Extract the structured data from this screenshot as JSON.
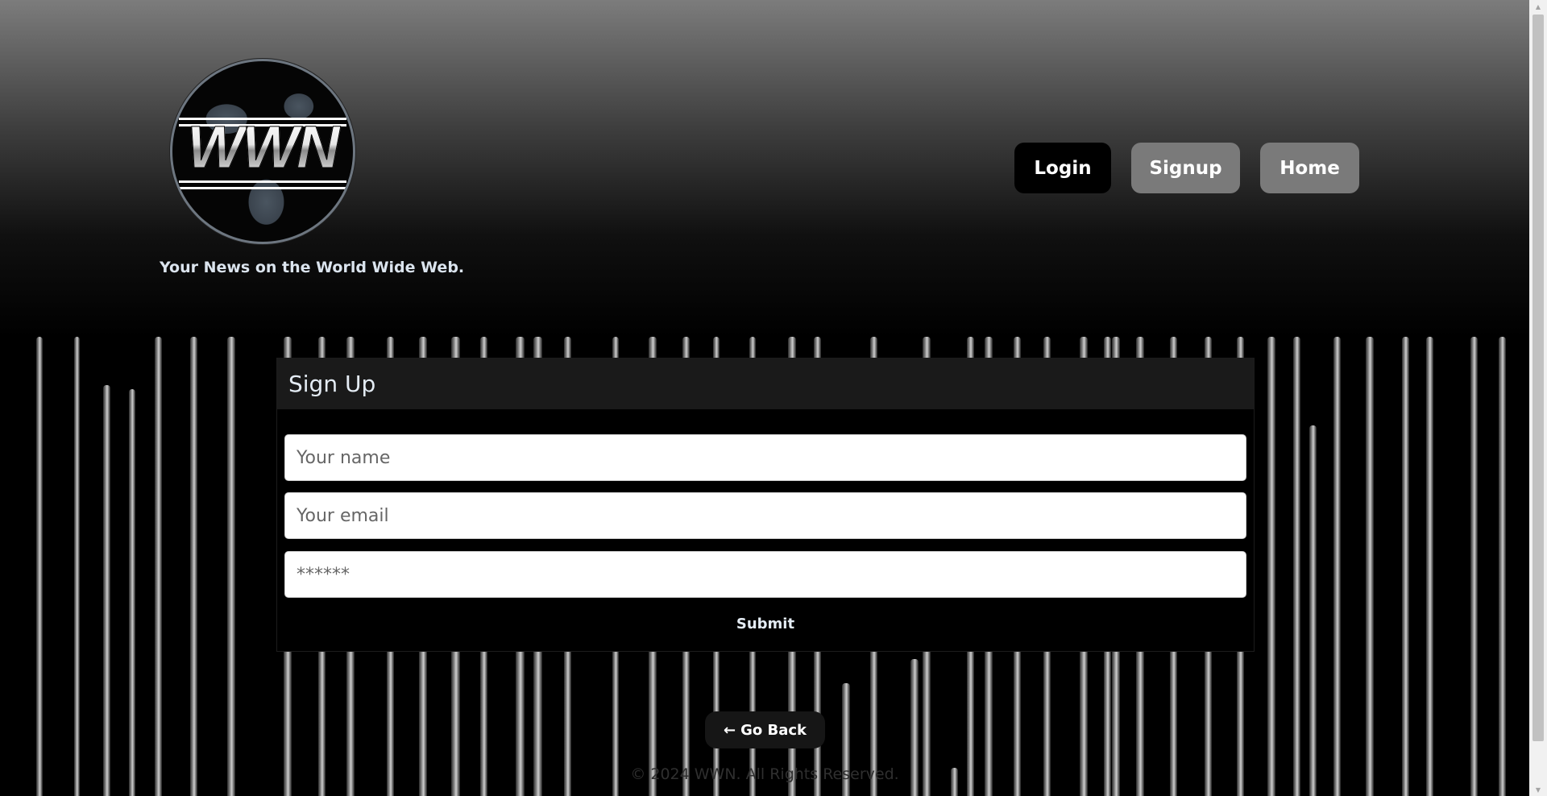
{
  "brand": {
    "logo_text": "WWN",
    "tagline": "Your News on the World Wide Web."
  },
  "nav": {
    "login": "Login",
    "signup": "Signup",
    "home": "Home"
  },
  "form": {
    "title": "Sign Up",
    "name_placeholder": "Your name",
    "email_placeholder": "Your email",
    "password_placeholder": "******",
    "submit": "Submit"
  },
  "back_button": {
    "arrow": "←",
    "label": "Go Back"
  },
  "footer": {
    "text": "© 2024 WWN. All Rights Reserved."
  },
  "colors": {
    "active_nav": "#000000",
    "inactive_nav": "#7a7a7a",
    "header_top": "#7c7c7c",
    "card_header": "#1a1a1a"
  },
  "icons": {
    "back": "left-arrow-icon",
    "scroll_up": "triangle-up-icon",
    "scroll_down": "triangle-down-icon"
  }
}
